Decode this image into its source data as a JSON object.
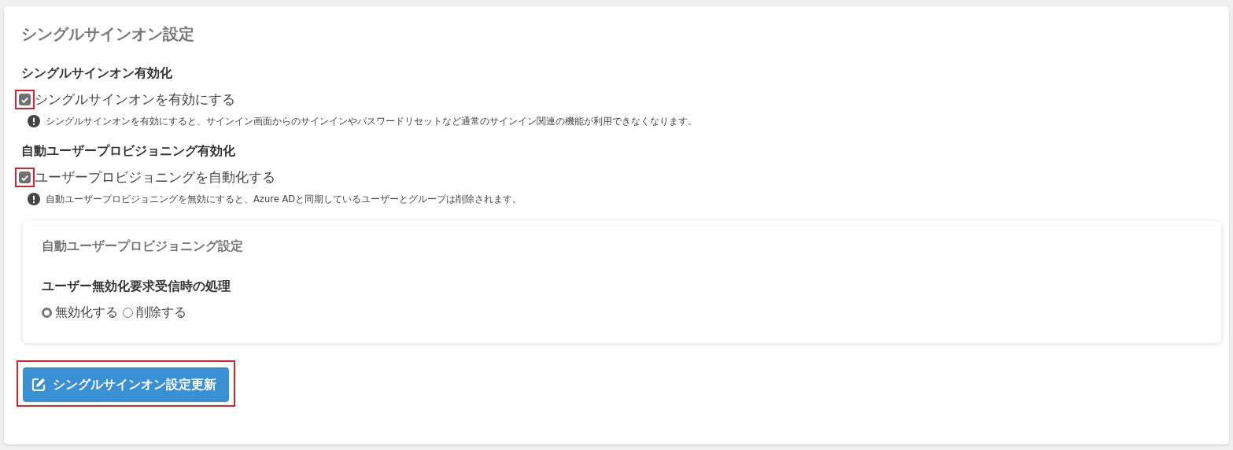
{
  "title": "シングルサインオン設定",
  "sections": [
    {
      "heading": "シングルサインオン有効化",
      "checkbox": {
        "label": "シングルサインオンを有効にする",
        "checked": true,
        "highlighted": true
      },
      "note": "シングルサインオンを有効にすると、サインイン画面からのサインインやパスワードリセットなど通常のサインイン関連の機能が利用できなくなります。"
    },
    {
      "heading": "自動ユーザープロビジョニング有効化",
      "checkbox": {
        "label": "ユーザープロビジョニングを自動化する",
        "checked": true,
        "highlighted": true
      },
      "note": "自動ユーザープロビジョニングを無効にすると、Azure ADと同期しているユーザーとグループは削除されます。"
    }
  ],
  "sub_panel": {
    "title": "自動ユーザープロビジョニング設定",
    "field_label": "ユーザー無効化要求受信時の処理",
    "options": [
      {
        "label": "無効化する",
        "selected": true
      },
      {
        "label": "削除する",
        "selected": false
      }
    ]
  },
  "submit_button": {
    "label": "シングルサインオン設定更新",
    "highlighted": true
  }
}
